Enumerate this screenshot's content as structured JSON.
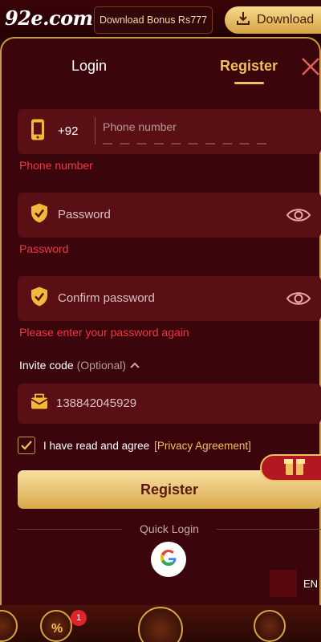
{
  "header": {
    "logo_text": "92e.com",
    "bonus_text": "Download Bonus Rs777",
    "download_label": "Download"
  },
  "tabs": {
    "login": "Login",
    "register": "Register"
  },
  "phone": {
    "country_code": "+92",
    "placeholder": "Phone number",
    "mask": "— — — — — — — — — —",
    "error": "Phone number"
  },
  "password": {
    "placeholder": "Password",
    "error": "Password"
  },
  "confirm": {
    "placeholder": "Confirm password",
    "error": "Please enter your password again"
  },
  "invite": {
    "label": "Invite code",
    "optional": "(Optional)",
    "value": "138842045929"
  },
  "agreement": {
    "text": "I have read and agree",
    "link": "[Privacy Agreement]",
    "checked": true
  },
  "register_button": "Register",
  "quick_login": "Quick Login",
  "language": "EN",
  "bottom": {
    "badge_count": "1"
  },
  "colors": {
    "accent_gold": "#f0c060",
    "error_red": "#f23545",
    "panel_bg": "#3a060b",
    "field_bg": "#5a0f14"
  }
}
